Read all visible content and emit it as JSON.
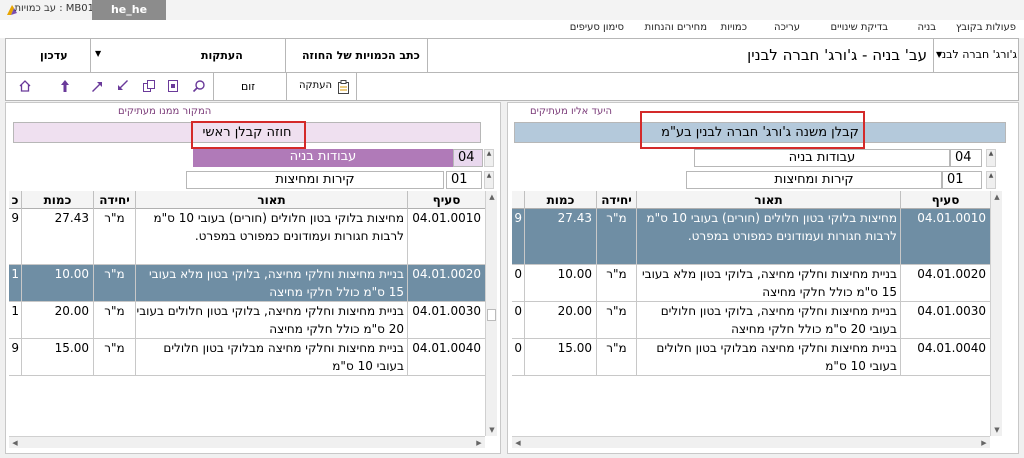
{
  "window": {
    "title": "MB01 : עב כמויות",
    "user": "he_he"
  },
  "menu": [
    "פעולות בקובץ",
    "בניה",
    "בדיקת שינויים",
    "עריכה",
    "כמויות",
    "מחירים והנחות",
    "סימון סעיפים"
  ],
  "toolbar": {
    "project_select": "ג'ורג' חברה לבני",
    "project_name": "עב' בניה - ג'ורג' חברה לבנין",
    "doc_label": "כתב הכמויות של החוזה",
    "copies_label": "העתקות",
    "update_label": "עדכון",
    "copy_button": "העתקה",
    "zoom_label": "זום"
  },
  "left_panel": {
    "title": "המקור ממנו מעתיקים",
    "contractor": "חוזה קבלן ראשי",
    "chapter_num": "04",
    "chapter_name": "עבודות בניה",
    "sub_num": "01",
    "sub_name": "קירות ומחיצות",
    "col_partial": "כ",
    "first_col_digits": [
      "9",
      "1",
      "1",
      "9"
    ]
  },
  "right_panel": {
    "title": "היעד אליו מעתיקים",
    "contractor": "קבלן משנה ג'ורג' חברה לבנין בע\"מ",
    "chapter_num": "04",
    "chapter_name": "עבודות בניה",
    "sub_num": "01",
    "sub_name": "קירות ומחיצות",
    "first_col_digits": [
      "9",
      "0",
      "0",
      "0"
    ]
  },
  "table": {
    "headers": {
      "code": "סעיף",
      "desc": "תאור",
      "unit": "יחידה",
      "qty": "כמות"
    },
    "rows": [
      {
        "code": "04.01.0010",
        "desc": "מחיצות בלוקי בטון חלולים (חורים) בעובי 10 ס\"מ לרבות חגורות ועמודונים כמפורט במפרט.",
        "unit": "מ\"ר",
        "qty": "27.43"
      },
      {
        "code": "04.01.0020",
        "desc": "בניית מחיצות וחלקי מחיצה, בלוקי בטון מלא בעובי 15 ס\"מ כולל חלקי מחיצה",
        "unit": "מ\"ר",
        "qty": "10.00"
      },
      {
        "code": "04.01.0030",
        "desc": "בניית מחיצות וחלקי מחיצה, בלוקי בטון חלולים בעובי 20 ס\"מ כולל חלקי מחיצה",
        "unit": "מ\"ר",
        "qty": "20.00"
      },
      {
        "code": "04.01.0040",
        "desc": "בניית מחיצות וחלקי מחיצה מבלוקי בטון חלולים בעובי 10 ס\"מ",
        "unit": "מ\"ר",
        "qty": "15.00"
      }
    ]
  },
  "colors": {
    "selected_row": "#6f8ea4",
    "chapter_left": "#b07ab8",
    "chapter_bg": "#e9d8ee",
    "contractor_left_bg": "#efe0f0",
    "contractor_right_bg": "#b4c9db",
    "highlight_box": "#d42a2a",
    "panel_title": "#7a3a78"
  }
}
